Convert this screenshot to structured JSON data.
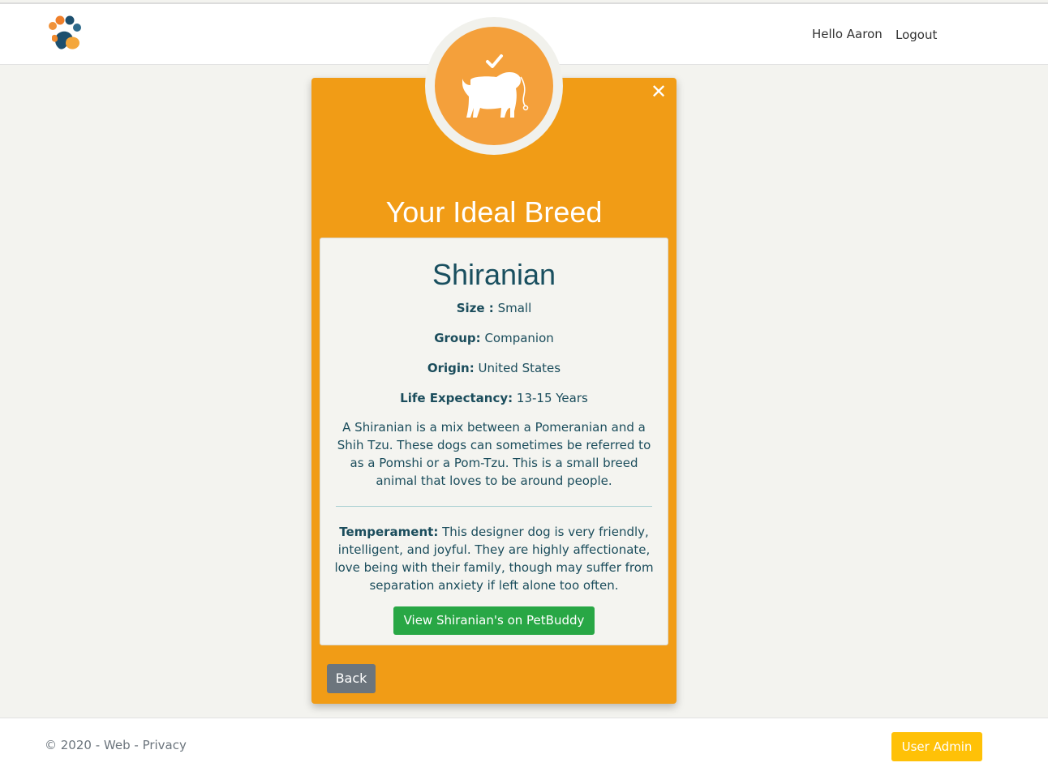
{
  "header": {
    "logo_icon": "paw-logo-icon",
    "greeting": "Hello Aaron",
    "logout_label": "Logout"
  },
  "card": {
    "badge_icon": "dog-check-icon",
    "close_icon": "close-icon",
    "title": "Your Ideal Breed",
    "breed": {
      "name": "Shiranian",
      "size_label": "Size :",
      "size_value": "Small",
      "group_label": "Group:",
      "group_value": "Companion",
      "origin_label": "Origin:",
      "origin_value": "United States",
      "life_label": "Life Expectancy:",
      "life_value": "13-15 Years",
      "description": "A Shiranian is a mix between a Pomeranian and a Shih Tzu. These dogs can sometimes be referred to as a Pomshi or a Pom-Tzu. This is a small breed animal that loves to be around people.",
      "temperament_label": "Temperament:",
      "temperament_value": "This designer dog is very friendly, intelligent, and joyful. They are highly affectionate, love being with their family, though may suffer from separation anxiety if left alone too often."
    },
    "view_button_label": "View Shiranian's on PetBuddy",
    "back_button_label": "Back"
  },
  "footer": {
    "copyright": "© 2020",
    "sep1": " - ",
    "web_link": "Web",
    "sep2": " - ",
    "privacy_link": "Privacy",
    "admin_button_label": "User Admin"
  },
  "colors": {
    "card_orange": "#f19c16",
    "badge_orange": "#f4a03b",
    "success_green": "#28a745",
    "secondary_gray": "#6c757d",
    "warning_yellow": "#ffc107",
    "text_teal": "#1b4d5c"
  }
}
